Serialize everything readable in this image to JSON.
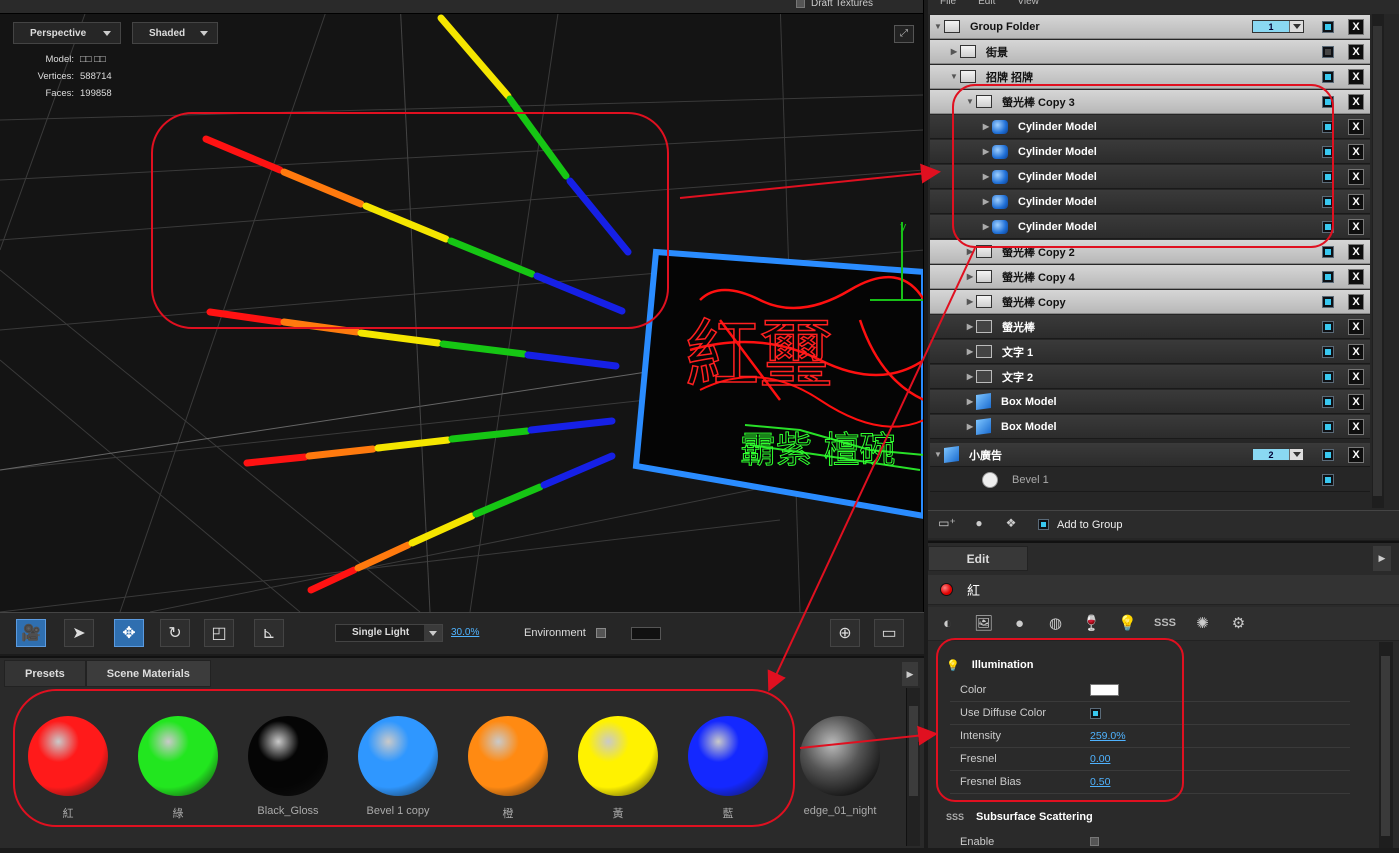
{
  "viewport": {
    "top_label": "Draft Textures",
    "view_mode": "Perspective",
    "shade_mode": "Shaded",
    "stats": [
      {
        "label": "Model:",
        "value": "□□ □□"
      },
      {
        "label": "Vertices:",
        "value": "588714"
      },
      {
        "label": "Faces:",
        "value": "199858"
      }
    ],
    "sign_text_main": "紅璽",
    "sign_text_sub": "霸紫 檀碗",
    "axis_y": "y"
  },
  "toolbar": {
    "light": "Single Light",
    "light_pct": "30.0%",
    "environment": "Environment"
  },
  "materials": {
    "tabs": [
      "Presets",
      "Scene Materials"
    ],
    "items": [
      {
        "name": "紅",
        "color": "#ff1a1a"
      },
      {
        "name": "綠",
        "color": "#22e61f"
      },
      {
        "name": "Black_Gloss",
        "color": "#050505"
      },
      {
        "name": "Bevel 1 copy",
        "color": "#2f97ff"
      },
      {
        "name": "橙",
        "color": "#ff8a12"
      },
      {
        "name": "黃",
        "color": "#fff200"
      },
      {
        "name": "藍",
        "color": "#1428ff"
      },
      {
        "name": "edge_01_night",
        "color": "#555555"
      }
    ]
  },
  "tree": {
    "menu": [
      "File",
      "Edit",
      "View"
    ],
    "rows": [
      {
        "label": "Group Folder",
        "count": "1"
      },
      {
        "label": "街景"
      },
      {
        "label": "招牌 招牌"
      },
      {
        "label": "螢光棒 Copy 3"
      },
      {
        "label": "Cylinder Model"
      },
      {
        "label": "Cylinder Model"
      },
      {
        "label": "Cylinder Model"
      },
      {
        "label": "Cylinder Model"
      },
      {
        "label": "Cylinder Model"
      },
      {
        "label": "螢光棒 Copy 2"
      },
      {
        "label": "螢光棒 Copy 4"
      },
      {
        "label": "螢光棒 Copy"
      },
      {
        "label": "螢光棒"
      },
      {
        "label": "文字 1"
      },
      {
        "label": "文字 2"
      },
      {
        "label": "Box Model"
      },
      {
        "label": "Box Model"
      },
      {
        "label": "小廣告",
        "count": "2"
      },
      {
        "label": "Bevel 1"
      }
    ],
    "add_to_group": "Add to Group"
  },
  "edit": {
    "tab": "Edit",
    "material_name": "紅",
    "sss_label": "SSS",
    "illumination": {
      "title": "Illumination",
      "color_label": "Color",
      "use_diffuse_label": "Use Diffuse Color",
      "intensity_label": "Intensity",
      "intensity": "259.0%",
      "fresnel_label": "Fresnel",
      "fresnel": "0.00",
      "fresnel_bias_label": "Fresnel Bias",
      "fresnel_bias": "0.50"
    },
    "sss": {
      "title": "Subsurface Scattering",
      "enable_label": "Enable"
    }
  }
}
